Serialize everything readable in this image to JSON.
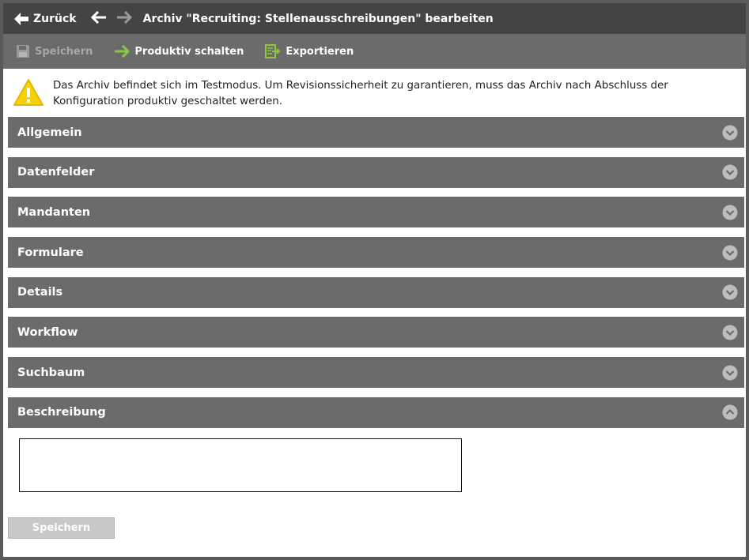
{
  "header": {
    "back_label": "Zurück",
    "title": "Archiv \"Recruiting: Stellenausschreibungen\" bearbeiten"
  },
  "toolbar": {
    "save_label": "Speichern",
    "productive_label": "Produktiv schalten",
    "export_label": "Exportieren"
  },
  "warning": {
    "text": "Das Archiv befindet sich im Testmodus. Um Revisionssicherheit zu garantieren, muss das Archiv nach Abschluss der Konfiguration produktiv geschaltet werden."
  },
  "sections": [
    {
      "title": "Allgemein",
      "expanded": false
    },
    {
      "title": "Datenfelder",
      "expanded": false
    },
    {
      "title": "Mandanten",
      "expanded": false
    },
    {
      "title": "Formulare",
      "expanded": false
    },
    {
      "title": "Details",
      "expanded": false
    },
    {
      "title": "Workflow",
      "expanded": false
    },
    {
      "title": "Suchbaum",
      "expanded": false
    },
    {
      "title": "Beschreibung",
      "expanded": true
    }
  ],
  "description": {
    "value": ""
  },
  "footer": {
    "save_label": "Speichern"
  },
  "colors": {
    "titlebar": "#444444",
    "toolbar": "#6b6b6b",
    "section_header": "#6b6b6b",
    "accent_green": "#8dc63f",
    "warning_yellow": "#f5d10a"
  }
}
